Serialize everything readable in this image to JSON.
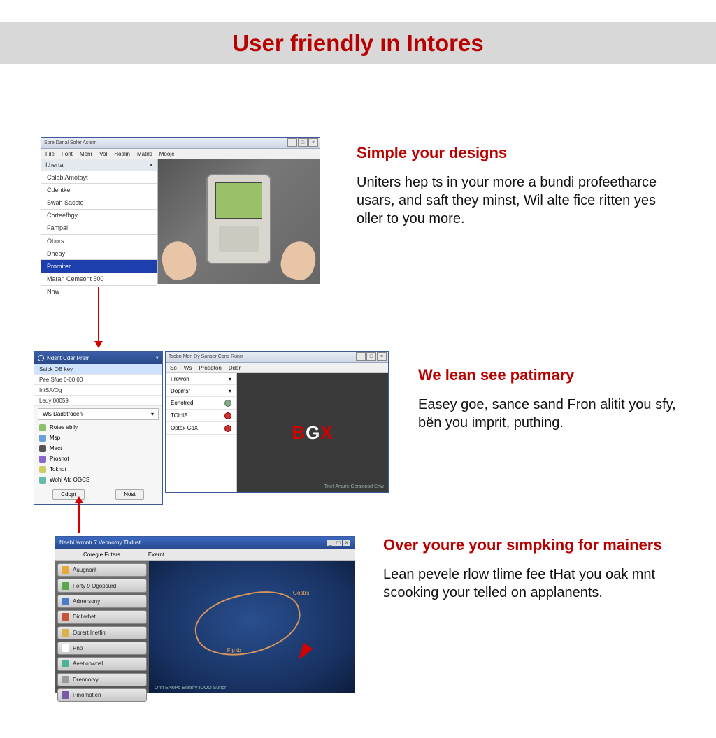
{
  "title": "User friendly ın Intores",
  "section1": {
    "window_title": "Sore Danal Sofer Astern",
    "menu": [
      "File",
      "Font",
      "Menr",
      "Vol",
      "Hoalin",
      "Matrls",
      "Mooje"
    ],
    "sidebar_header": "Ithertan",
    "sidebar": [
      "Calab Amotayt",
      "Cdentke",
      "Swah Sacste",
      "Corteefhgy",
      "Fampal",
      "Obors",
      "Dheay",
      "Promiter",
      "Maran Cemsont 500",
      "Nhw"
    ],
    "sidebar_selected": 7,
    "heading": "Simple your designs",
    "body": "Uniters hep ts in your more a bundi profeetharce usars, and saft they minst, Wil alte fice ritten yes oller to you more."
  },
  "section2": {
    "left_title": "Ndsnt Cder Prerr",
    "left_list": [
      "Saick OB key",
      "Pee Sfue 0-00 00",
      "IntSA/Og",
      "Leuy 00059"
    ],
    "left_dropdown": "WS Daddtroden",
    "left_options": [
      {
        "label": "Rotee abily",
        "color": "#8fbf6a"
      },
      {
        "label": "Msp",
        "color": "#6aa0d8"
      },
      {
        "label": "Mact",
        "color": "#555"
      },
      {
        "label": "Prosnot",
        "color": "#8866cc"
      },
      {
        "label": "Tokhot",
        "color": "#cc6"
      },
      {
        "label": "Wohl Afc OGCS",
        "color": "#66bbaa"
      }
    ],
    "left_btn1": "Cdopt",
    "left_btn2": "Nost",
    "right_title": "Tsobn Men Dy Sanser Cons Runrr",
    "right_menu": [
      "So",
      "Ws",
      "Proedton",
      "Dder"
    ],
    "right_options": [
      "Frowoh",
      "Dopmsr",
      "Eonotred",
      "TOldlS",
      "Optox CoX"
    ],
    "right_footer": "Tnet Anaire Cersionsd Chw",
    "logo": "B X",
    "heading": "We lean see patimary",
    "body": "Easey goe, sance sand Fron alitit you sfy, bën you imprit, puthing."
  },
  "section3": {
    "title": "NeabUwrontr 7 Vennotny Thdust",
    "tabs": [
      "Coregle Futers",
      "Exernt"
    ],
    "nav": [
      {
        "label": "Auugnorit",
        "color": "#e6a83a"
      },
      {
        "label": "Forty 9 Ogopsurd",
        "color": "#5aa84a"
      },
      {
        "label": "Arbrersony",
        "color": "#4a7cc9"
      },
      {
        "label": "Dichwhet",
        "color": "#c9533a"
      },
      {
        "label": "Oprert Inetfirr",
        "color": "#d9b24a"
      },
      {
        "label": "Pnp",
        "color": "#fff"
      },
      {
        "label": "Aeetionwosl",
        "color": "#4ab39a"
      },
      {
        "label": "Drennorvy",
        "color": "#9a9a9a"
      },
      {
        "label": "Pmomotien",
        "color": "#7a5aa8"
      }
    ],
    "map_label1": "Gostrs",
    "map_label2": "Fip tb",
    "caption": "Onh EN0Po Ennriry IOOO  Sunpr",
    "heading": "Over youre your sımpking for mainers",
    "body": "Lean pevele rlow tlime fee tHat you oak mnt ꜱcooking your telled on applanents."
  }
}
